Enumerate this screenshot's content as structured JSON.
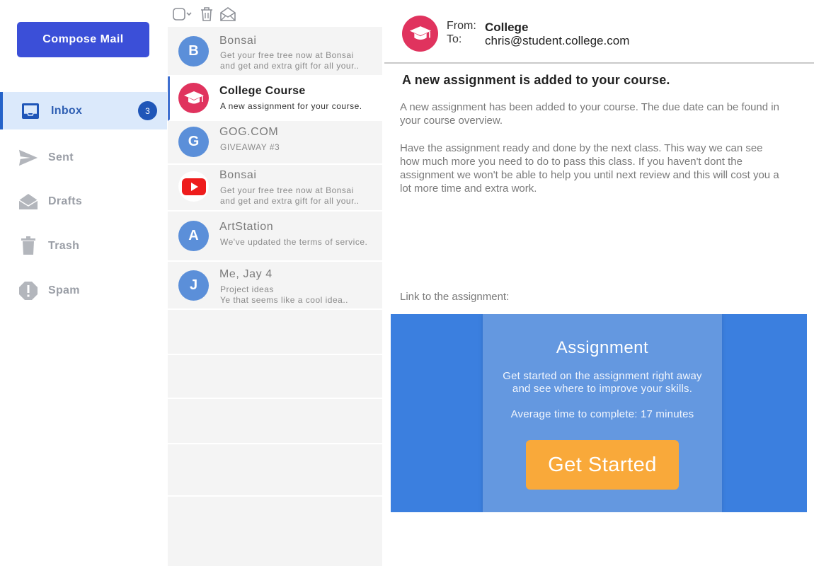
{
  "sidebar": {
    "compose_label": "Compose Mail",
    "items": [
      {
        "label": "Inbox",
        "icon": "inbox-icon",
        "badge": "3",
        "active": true
      },
      {
        "label": "Sent",
        "icon": "send-icon"
      },
      {
        "label": "Drafts",
        "icon": "drafts-icon"
      },
      {
        "label": "Trash",
        "icon": "trash-icon"
      },
      {
        "label": "Spam",
        "icon": "spam-icon"
      }
    ]
  },
  "toolbar": {
    "icons": [
      "select-all-checkbox-icon",
      "delete-icon",
      "mark-read-icon"
    ]
  },
  "mail_list": [
    {
      "avatar": "B",
      "sender": "Bonsai",
      "lines": [
        "Get your free tree now at Bonsai",
        "and get and extra gift for all your.."
      ]
    },
    {
      "avatar": "graduation-cap-icon",
      "sender": "College Course",
      "lines": [
        "A new assignment for your course."
      ],
      "selected": true
    },
    {
      "avatar": "G",
      "sender": "GOG.COM",
      "lines": [
        "GIVEAWAY #3"
      ]
    },
    {
      "avatar": "youtube-icon",
      "sender": "Bonsai",
      "lines": [
        "Get your free tree now at Bonsai",
        "and get and extra gift for all your.."
      ]
    },
    {
      "avatar": "A",
      "sender": "ArtStation",
      "lines": [
        "We've updated the terms of service."
      ]
    },
    {
      "avatar": "J",
      "sender": "Me, Jay 4",
      "lines": [
        "Project ideas",
        "Ye that seems like a cool idea.."
      ]
    }
  ],
  "email": {
    "from_label": "From:",
    "to_label": "To:",
    "from": "College",
    "to": "chris@student.college.com",
    "subject": "A new assignment is added to your course.",
    "paragraph1": "A new assignment has been added to your course. The due date can be found in your course overview.",
    "paragraph2": "Have the assignment ready and done by the next class. This way we can see how much more you need to do to pass this class. If you haven't dont the assignment we won't be able to help you until next review and this will cost you a lot more time and extra work.",
    "link_label": "Link to the assignment:",
    "card": {
      "title": "Assignment",
      "text": "Get started on the assignment right away and see where to improve your skills.",
      "time": "Average time to complete: 17 minutes",
      "button": "Get Started"
    }
  },
  "colors": {
    "compose": "#3b4fd8",
    "active_nav_bg": "#dbe9fb",
    "badge": "#1f56b8",
    "avatar_blue": "#5b8fd9",
    "college_red": "#e0335e",
    "card_blue": "#3b7fdf",
    "cta_orange": "#f9a93a"
  }
}
